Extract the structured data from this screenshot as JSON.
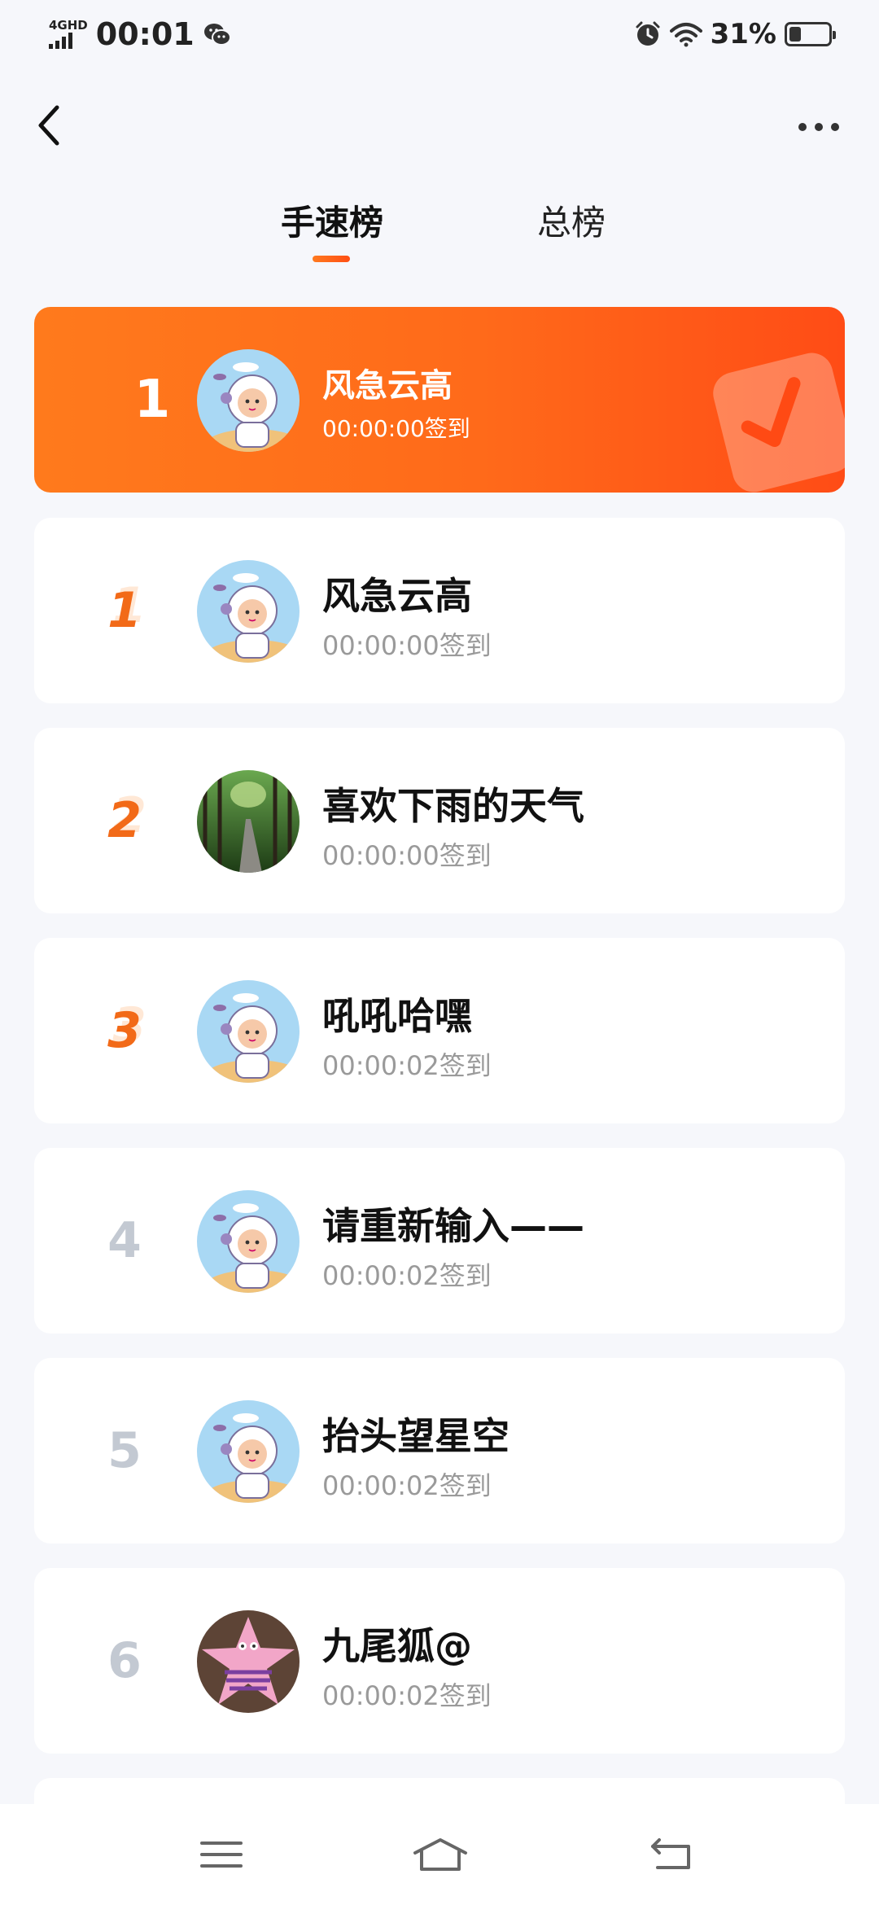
{
  "status_bar": {
    "network": "4GHD",
    "time": "00:01",
    "battery_pct": "31%",
    "battery_level": 0.31,
    "icons": [
      "signal-icon",
      "wechat-icon",
      "alarm-icon",
      "wifi-icon",
      "battery-icon"
    ]
  },
  "header": {
    "back_icon": "chevron-left-icon",
    "more_icon": "more-dots-icon"
  },
  "tabs": [
    {
      "label": "手速榜",
      "active": true
    },
    {
      "label": "总榜",
      "active": false
    }
  ],
  "highlight": {
    "rank": "1",
    "name": "风急云高",
    "time": "00:00:00签到",
    "badge_icon": "checkin-check-icon"
  },
  "entries": [
    {
      "rank": "1",
      "name": "风急云高",
      "time": "00:00:00签到",
      "avatar": "astronaut"
    },
    {
      "rank": "2",
      "name": "喜欢下雨的天气",
      "time": "00:00:00签到",
      "avatar": "forest"
    },
    {
      "rank": "3",
      "name": "吼吼哈嘿",
      "time": "00:00:02签到",
      "avatar": "astronaut"
    },
    {
      "rank": "4",
      "name": "请重新输入——",
      "time": "00:00:02签到",
      "avatar": "astronaut"
    },
    {
      "rank": "5",
      "name": "抬头望星空",
      "time": "00:00:02签到",
      "avatar": "astronaut"
    },
    {
      "rank": "6",
      "name": "九尾狐@",
      "time": "00:00:02签到",
      "avatar": "starfish"
    }
  ],
  "nav_bar": {
    "icons": [
      "menu-icon",
      "home-icon",
      "back-icon"
    ]
  },
  "colors": {
    "accent": "#ff6a1a",
    "accent_dark": "#ff4c16",
    "rank_top": "#f26a18",
    "rank_other": "#c3c9d2",
    "time_gray": "#9a9a9a",
    "background": "#f6f7fb"
  }
}
